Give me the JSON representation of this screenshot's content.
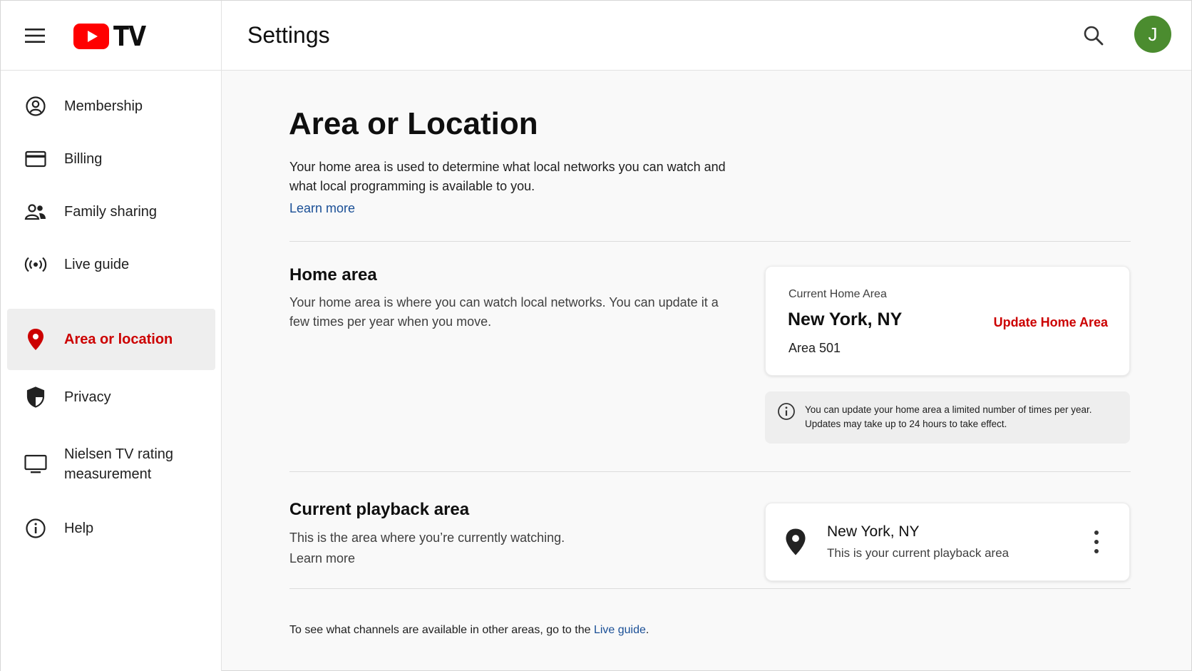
{
  "header": {
    "logo_text": "TV",
    "title": "Settings",
    "avatar_initial": "J",
    "avatar_color": "#4b8c2f",
    "menu_icon": "hamburger-icon",
    "search_icon": "search-icon"
  },
  "sidebar": {
    "items": [
      {
        "label": "Membership",
        "icon": "account-circle-icon",
        "active": false
      },
      {
        "label": "Billing",
        "icon": "credit-card-icon",
        "active": false
      },
      {
        "label": "Family sharing",
        "icon": "people-icon",
        "active": false
      },
      {
        "label": "Live guide",
        "icon": "broadcast-icon",
        "active": false
      },
      {
        "label": "Area or location",
        "icon": "location-pin-icon",
        "active": true
      },
      {
        "label": "Privacy",
        "icon": "shield-icon",
        "active": false
      },
      {
        "label": "Nielsen TV rating measurement",
        "icon": "monitor-icon",
        "active": false
      },
      {
        "label": "Help",
        "icon": "info-icon",
        "active": false
      }
    ]
  },
  "main": {
    "title": "Area or Location",
    "intro": "Your home area is used to determine what local networks you can watch and what local programming is available to you.",
    "intro_link": "Learn more",
    "home_area": {
      "title": "Home area",
      "description": "Your home area is where you can watch local networks. You can update it a few times per year when you move.",
      "card_label": "Current Home Area",
      "city": "New York, NY",
      "area": "Area 501",
      "update_button": "Update Home Area",
      "info_text": "You can update your home area a limited number of times per year. Updates may take up to 24 hours to take effect."
    },
    "playback": {
      "title": "Current playback area",
      "description": "This is the area where you’re currently watching.",
      "link": "Learn more",
      "city": "New York, NY",
      "subtitle": "This is your current playback area"
    },
    "footer": {
      "prefix": "To see what channels are available in other areas, go to the ",
      "link": "Live guide",
      "suffix": "."
    }
  },
  "colors": {
    "accent_red": "#cc0000",
    "link_blue": "#1a4f96"
  }
}
